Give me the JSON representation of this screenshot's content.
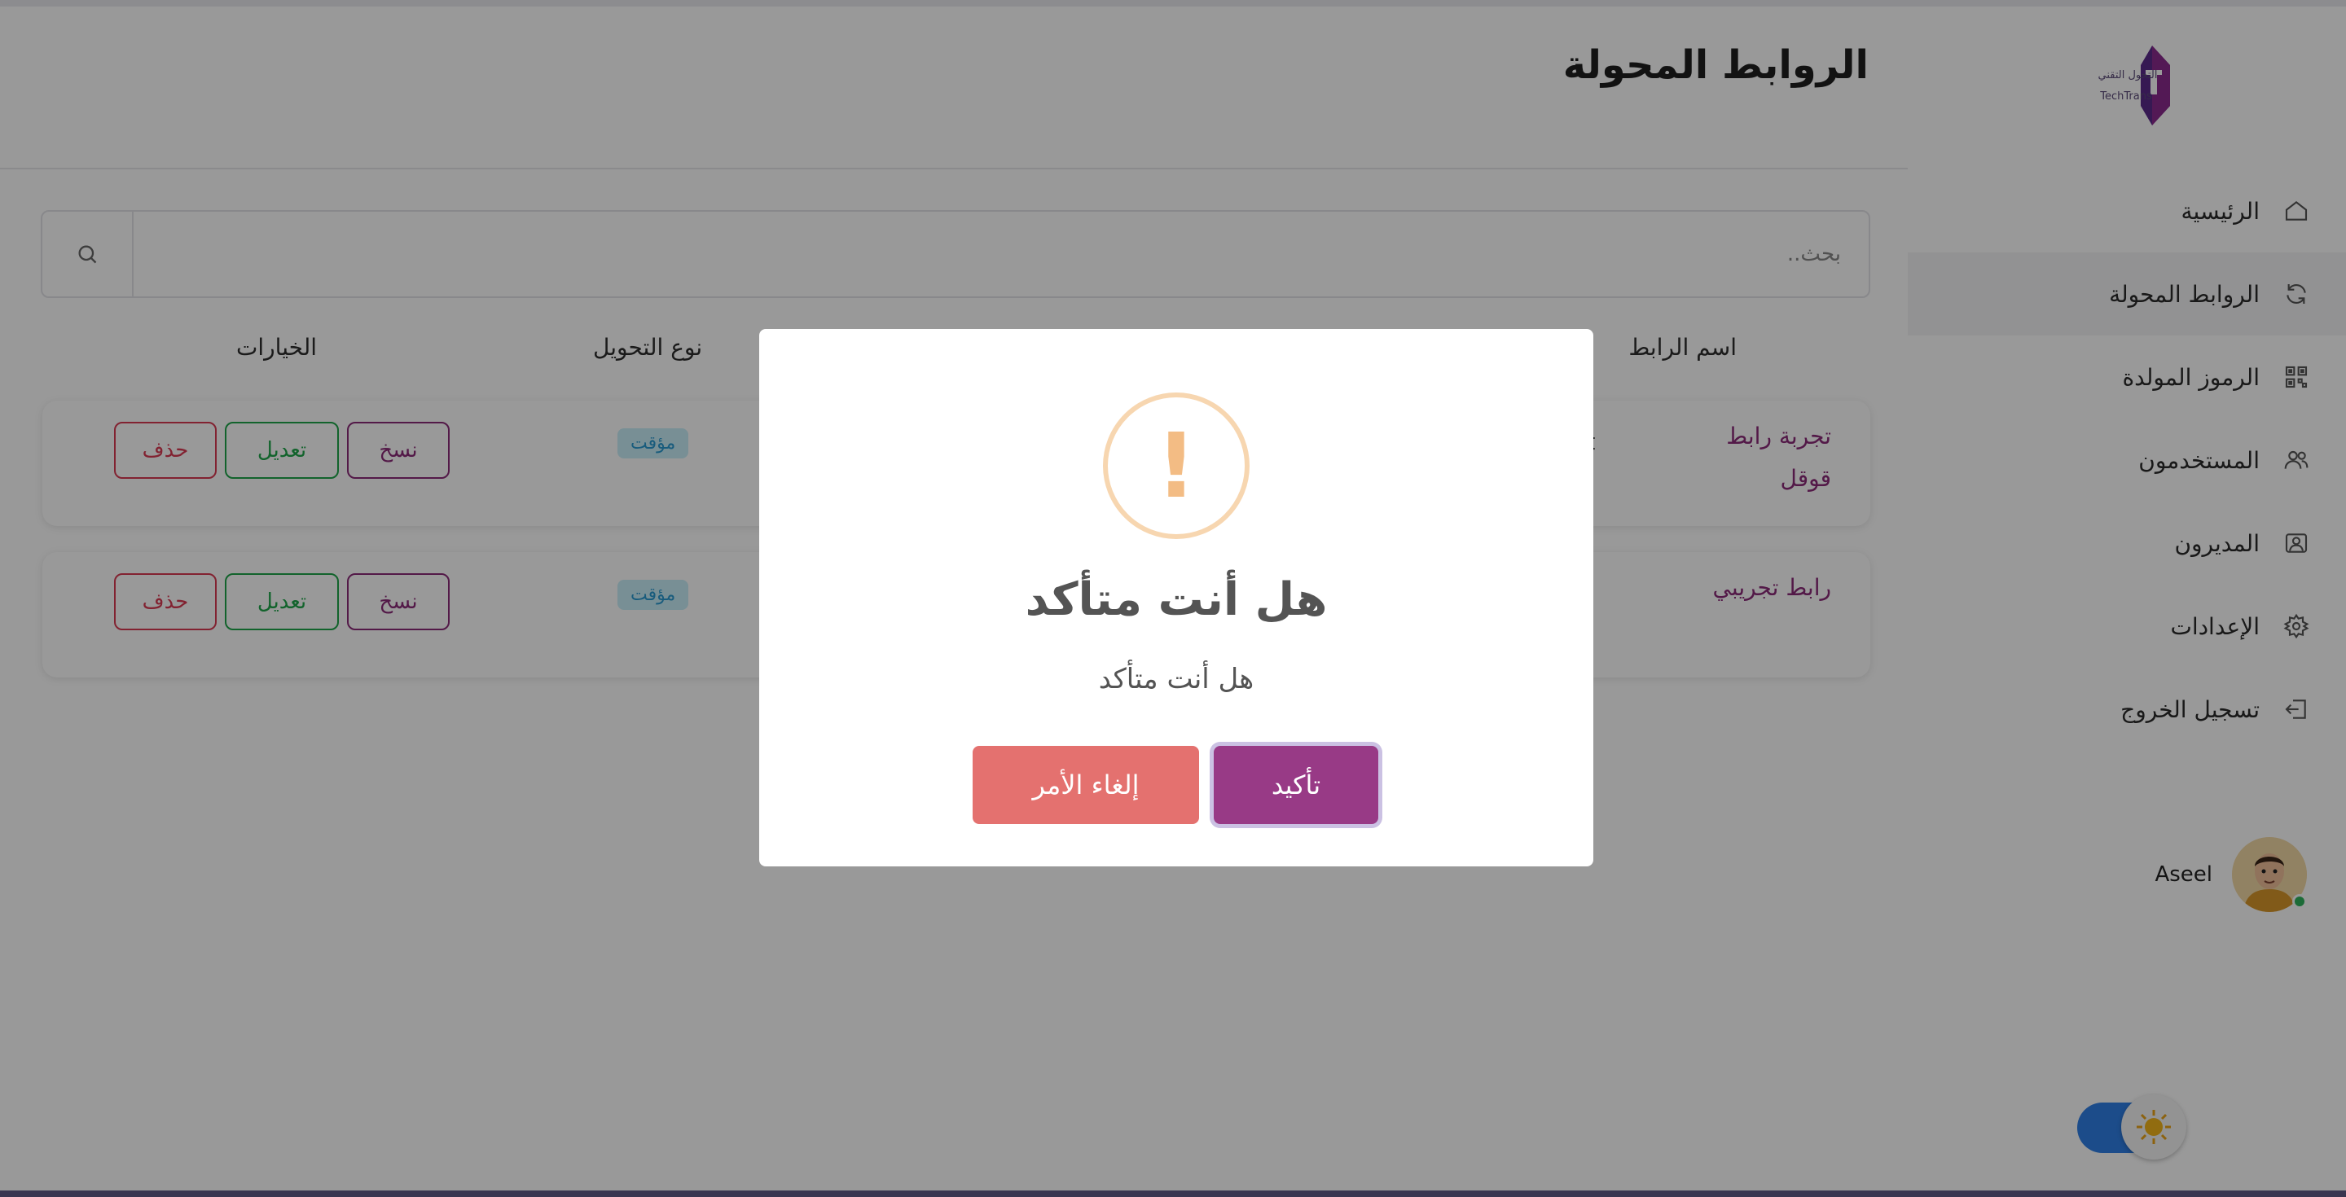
{
  "page": {
    "title": "الروابط المحولة"
  },
  "logo": {
    "text_ar": "التحول التقني",
    "text_en": "TechTrans"
  },
  "sidebar": {
    "items": [
      {
        "label": "الرئيسية",
        "icon": "home-icon"
      },
      {
        "label": "الروابط المحولة",
        "icon": "refresh-icon",
        "active": true
      },
      {
        "label": "الرموز المولدة",
        "icon": "qr-code-icon"
      },
      {
        "label": "المستخدمون",
        "icon": "users-icon"
      },
      {
        "label": "المديرون",
        "icon": "admin-badge-icon"
      },
      {
        "label": "الإعدادات",
        "icon": "gear-icon"
      },
      {
        "label": "تسجيل الخروج",
        "icon": "logout-icon"
      }
    ],
    "user": {
      "name": "Aseel"
    }
  },
  "search": {
    "placeholder": "بحث.."
  },
  "table": {
    "headers": {
      "name": "اسم الرابط",
      "type": "نوع التحويل",
      "options": "الخيارات"
    },
    "rows": [
      {
        "name_line1": "تجربة رابط",
        "name_line2": "قوقل",
        "partial": "ct",
        "type": "مؤقت",
        "copy": "نسخ",
        "edit": "تعديل",
        "delete": "حذف"
      },
      {
        "name_line1": "رابط تجريبي",
        "type": "مؤقت",
        "copy": "نسخ",
        "edit": "تعديل",
        "delete": "حذف"
      }
    ]
  },
  "modal": {
    "icon": "warning-icon",
    "title": "هل أنت متأكد",
    "text": "هل أنت متأكد",
    "confirm": "تأكيد",
    "cancel": "إلغاء الأمر"
  },
  "colors": {
    "brand": "#983a86",
    "cancel": "#e4716f",
    "link": "#8a2a78",
    "success": "#1fa64a",
    "danger": "#d93a52",
    "toggle": "#2f7fe6"
  }
}
